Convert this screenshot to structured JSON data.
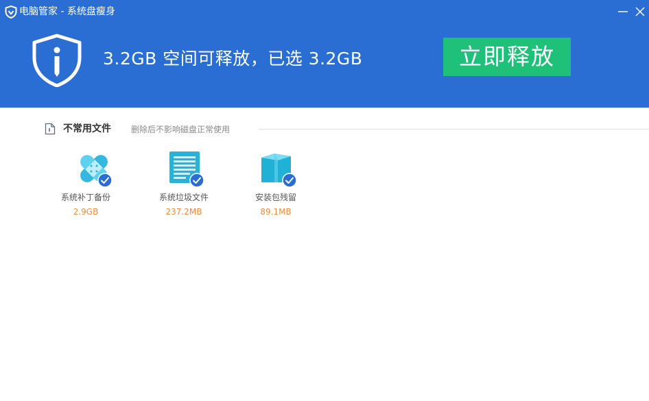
{
  "window": {
    "title": "电脑管家 - 系统盘瘦身",
    "minimize_icon": "minimize-icon",
    "close_icon": "close-icon"
  },
  "header": {
    "summary": "3.2GB 空间可释放，已选 3.2GB",
    "release_button": "立即释放",
    "logo_icon": "shield-info-icon"
  },
  "section": {
    "title": "不常用文件",
    "description": "删除后不影响磁盘正常使用",
    "icon": "document-icon"
  },
  "items": [
    {
      "label": "系统补丁备份",
      "size": "2.9GB",
      "icon": "bandage-icon",
      "checked": true
    },
    {
      "label": "系统垃圾文件",
      "size": "237.2MB",
      "icon": "text-document-icon",
      "checked": true
    },
    {
      "label": "安装包残留",
      "size": "89.1MB",
      "icon": "package-box-icon",
      "checked": true
    }
  ],
  "colors": {
    "header_bg": "#2a6ed4",
    "button_bg": "#1ec07a",
    "size_text": "#f08a3a",
    "check_bg": "#2a6ed4"
  }
}
